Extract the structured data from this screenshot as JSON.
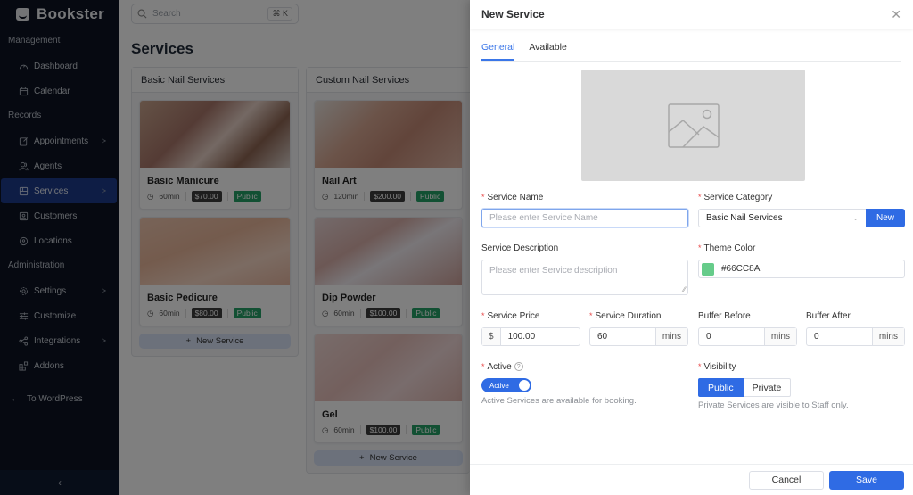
{
  "app": {
    "name": "Bookster"
  },
  "sidebar": {
    "sections": [
      {
        "label": "Management",
        "items": [
          {
            "label": "Dashboard",
            "icon": "gauge-icon",
            "chevron": false
          },
          {
            "label": "Calendar",
            "icon": "calendar-icon",
            "chevron": false
          }
        ]
      },
      {
        "label": "Records",
        "items": [
          {
            "label": "Appointments",
            "icon": "edit-icon",
            "chevron": true
          },
          {
            "label": "Agents",
            "icon": "users-icon",
            "chevron": false
          },
          {
            "label": "Services",
            "icon": "services-icon",
            "chevron": true,
            "active": true
          },
          {
            "label": "Customers",
            "icon": "contact-icon",
            "chevron": false
          },
          {
            "label": "Locations",
            "icon": "location-icon",
            "chevron": false
          }
        ]
      },
      {
        "label": "Administration",
        "items": [
          {
            "label": "Settings",
            "icon": "gear-icon",
            "chevron": true
          },
          {
            "label": "Customize",
            "icon": "sliders-icon",
            "chevron": false
          },
          {
            "label": "Integrations",
            "icon": "share-icon",
            "chevron": true
          },
          {
            "label": "Addons",
            "icon": "addons-icon",
            "chevron": false
          }
        ]
      }
    ],
    "to_wordpress": "To WordPress"
  },
  "topbar": {
    "search_placeholder": "Search",
    "shortcut": "⌘ K"
  },
  "page": {
    "title": "Services"
  },
  "columns": [
    {
      "title": "Basic Nail Services",
      "new_label": "New Service",
      "cards": [
        {
          "title": "Basic Manicure",
          "duration": "60min",
          "price": "$70.00",
          "visibility": "Public",
          "image": "manicure"
        },
        {
          "title": "Basic Pedicure",
          "duration": "60min",
          "price": "$80.00",
          "visibility": "Public",
          "image": "pedicure"
        }
      ]
    },
    {
      "title": "Custom Nail Services",
      "new_label": "New Service",
      "cards": [
        {
          "title": "Nail Art",
          "duration": "120min",
          "price": "$200.00",
          "visibility": "Public",
          "image": "nailart"
        },
        {
          "title": "Dip Powder",
          "duration": "60min",
          "price": "$100.00",
          "visibility": "Public",
          "image": "dip"
        },
        {
          "title": "Gel",
          "duration": "60min",
          "price": "$100.00",
          "visibility": "Public",
          "image": "gel"
        }
      ]
    }
  ],
  "drawer": {
    "title": "New Service",
    "tabs": [
      {
        "label": "General",
        "active": true
      },
      {
        "label": "Available",
        "active": false
      }
    ],
    "service_name": {
      "label": "Service Name",
      "placeholder": "Please enter Service Name",
      "value": ""
    },
    "service_category": {
      "label": "Service Category",
      "value": "Basic Nail Services",
      "new_label": "New"
    },
    "service_description": {
      "label": "Service Description",
      "placeholder": "Please enter Service description"
    },
    "theme_color": {
      "label": "Theme Color",
      "value": "#66CC8A"
    },
    "service_price": {
      "label": "Service Price",
      "prefix": "$",
      "value": "100.00"
    },
    "service_duration": {
      "label": "Service Duration",
      "value": "60",
      "suffix": "mins"
    },
    "buffer_before": {
      "label": "Buffer Before",
      "value": "0",
      "suffix": "mins"
    },
    "buffer_after": {
      "label": "Buffer After",
      "value": "0",
      "suffix": "mins"
    },
    "active": {
      "label": "Active",
      "toggle_label": "Active",
      "on": true,
      "help": "Active Services are available for booking."
    },
    "visibility": {
      "label": "Visibility",
      "options": [
        "Public",
        "Private"
      ],
      "selected": "Public",
      "help": "Private Services are visible to Staff only."
    },
    "cancel_label": "Cancel",
    "save_label": "Save"
  },
  "colors": {
    "accent": "#2F6BE4",
    "sidebar_bg": "#0C1322",
    "public_badge": "#25A067",
    "theme": "#66CC8A"
  }
}
